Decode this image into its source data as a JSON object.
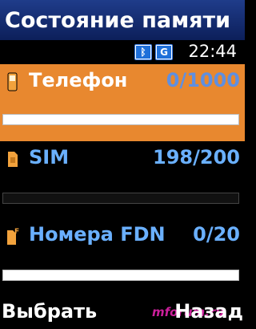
{
  "header": {
    "title": "Состояние памяти"
  },
  "status": {
    "icons": [
      {
        "name": "bluetooth-icon",
        "glyph": "ᛒ"
      },
      {
        "name": "gprs-icon",
        "glyph": "G"
      }
    ],
    "time": "22:44"
  },
  "memory": {
    "items": [
      {
        "label": "Телефон",
        "count": "0/1000",
        "used": 0,
        "total": 1000,
        "selected": true
      },
      {
        "label": "SIM",
        "count": "198/200",
        "used": 198,
        "total": 200,
        "selected": false
      },
      {
        "label": "Номера FDN",
        "count": "0/20",
        "used": 0,
        "total": 20,
        "selected": false
      }
    ]
  },
  "softkeys": {
    "left": "Выбрать",
    "right": "Назад"
  },
  "watermark": "mforum.ru"
}
